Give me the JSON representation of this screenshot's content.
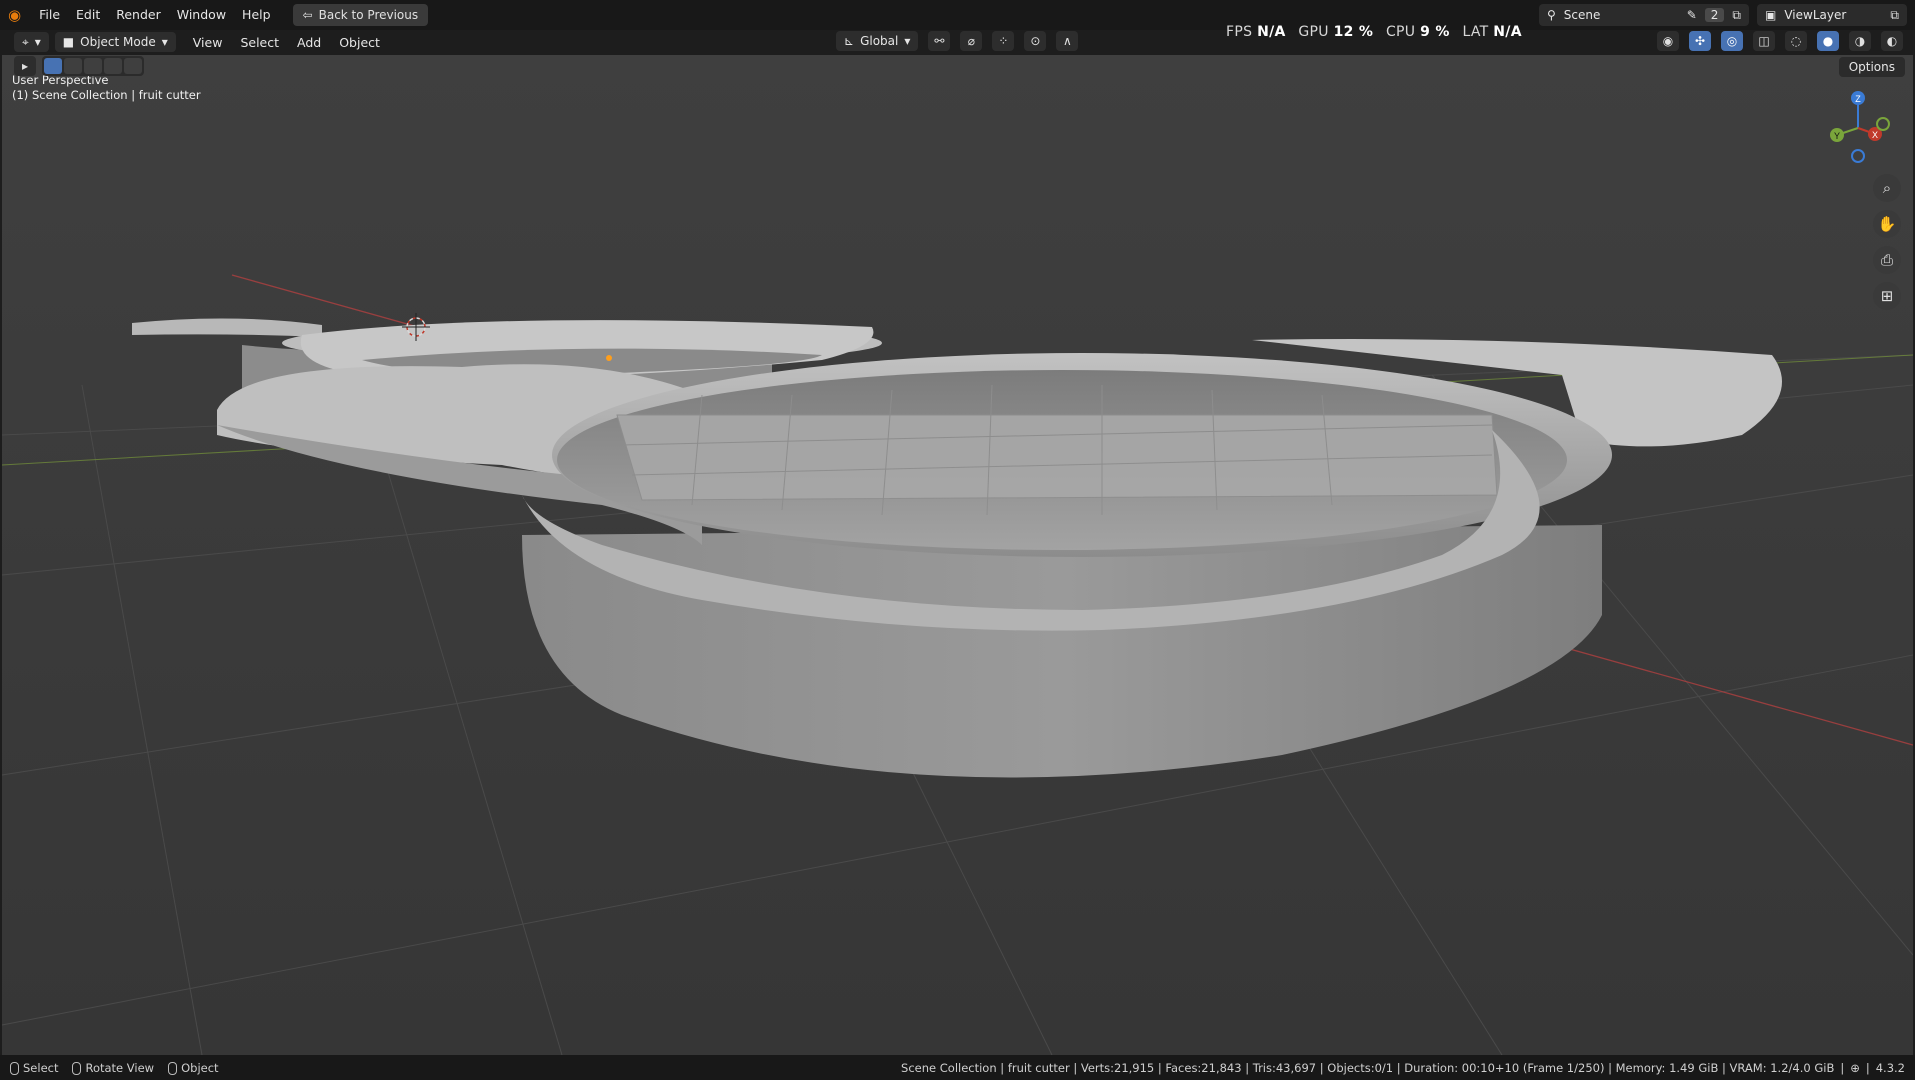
{
  "topbar": {
    "menus": [
      "File",
      "Edit",
      "Render",
      "Window",
      "Help"
    ],
    "back_button": "Back to Previous",
    "scene": "Scene",
    "scene_count": "2",
    "view_layer": "ViewLayer"
  },
  "header": {
    "mode": "Object Mode",
    "menus": [
      "View",
      "Select",
      "Add",
      "Object"
    ],
    "orientation": "Global",
    "options": "Options"
  },
  "stats": {
    "fps_label": "FPS",
    "fps_value": "N/A",
    "gpu_label": "GPU",
    "gpu_value": "12 %",
    "cpu_label": "CPU",
    "cpu_value": "9 %",
    "lat_label": "LAT",
    "lat_value": "N/A"
  },
  "viewport": {
    "perspective": "User Perspective",
    "collection": "(1) Scene Collection | fruit cutter"
  },
  "gizmo": {
    "z": "Z",
    "y": "Y",
    "x": "X"
  },
  "statusbar": {
    "select": "Select",
    "rotate": "Rotate View",
    "object": "Object",
    "info": "Scene Collection | fruit cutter | Verts:21,915 | Faces:21,843 | Tris:43,697 | Objects:0/1 | Duration: 00:10+10 (Frame 1/250) | Memory: 1.49 GiB | VRAM: 1.2/4.0 GiB",
    "version": "4.3.2"
  },
  "colors": {
    "accent": "#4772b3",
    "viewport_bg": "#3c3c3c",
    "axis_x": "#c0392b",
    "axis_y": "#7aa53b",
    "axis_z": "#3a7bd5"
  },
  "icons": [
    "blender-logo-icon",
    "back-icon",
    "scene-icon",
    "viewlayer-icon",
    "editor-type-icon",
    "object-mode-icon",
    "transform-orientation-icon",
    "snap-icon",
    "proportional-icon",
    "visibility-icon",
    "gizmo-icon",
    "overlay-icon",
    "xray-icon",
    "shading-wire-icon",
    "shading-solid-icon",
    "shading-material-icon",
    "shading-render-icon",
    "zoom-icon",
    "pan-icon",
    "camera-icon",
    "ortho-grid-icon",
    "mouse-left-icon",
    "mouse-middle-icon",
    "mouse-right-icon",
    "network-icon"
  ]
}
